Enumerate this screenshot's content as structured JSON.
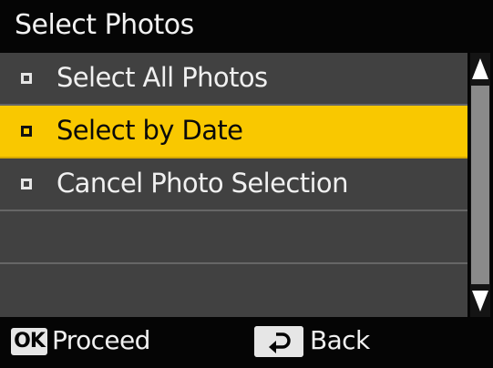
{
  "title": "Select Photos",
  "menu": {
    "items": [
      {
        "label": "Select All Photos",
        "selected": false
      },
      {
        "label": "Select by Date",
        "selected": true
      },
      {
        "label": "Cancel Photo Selection",
        "selected": false
      },
      {
        "label": "",
        "selected": false
      },
      {
        "label": "",
        "selected": false
      }
    ]
  },
  "footer": {
    "ok_key": "OK",
    "proceed_label": "Proceed",
    "back_label": "Back"
  },
  "icons": {
    "scroll_up": "triangle-up-icon",
    "scroll_down": "triangle-down-icon",
    "back": "return-arrow-icon",
    "bullet": "square-bullet-icon"
  },
  "colors": {
    "highlight": "#f9c800",
    "background": "#414141",
    "bars": "#050505",
    "text": "#f0f0f0"
  }
}
